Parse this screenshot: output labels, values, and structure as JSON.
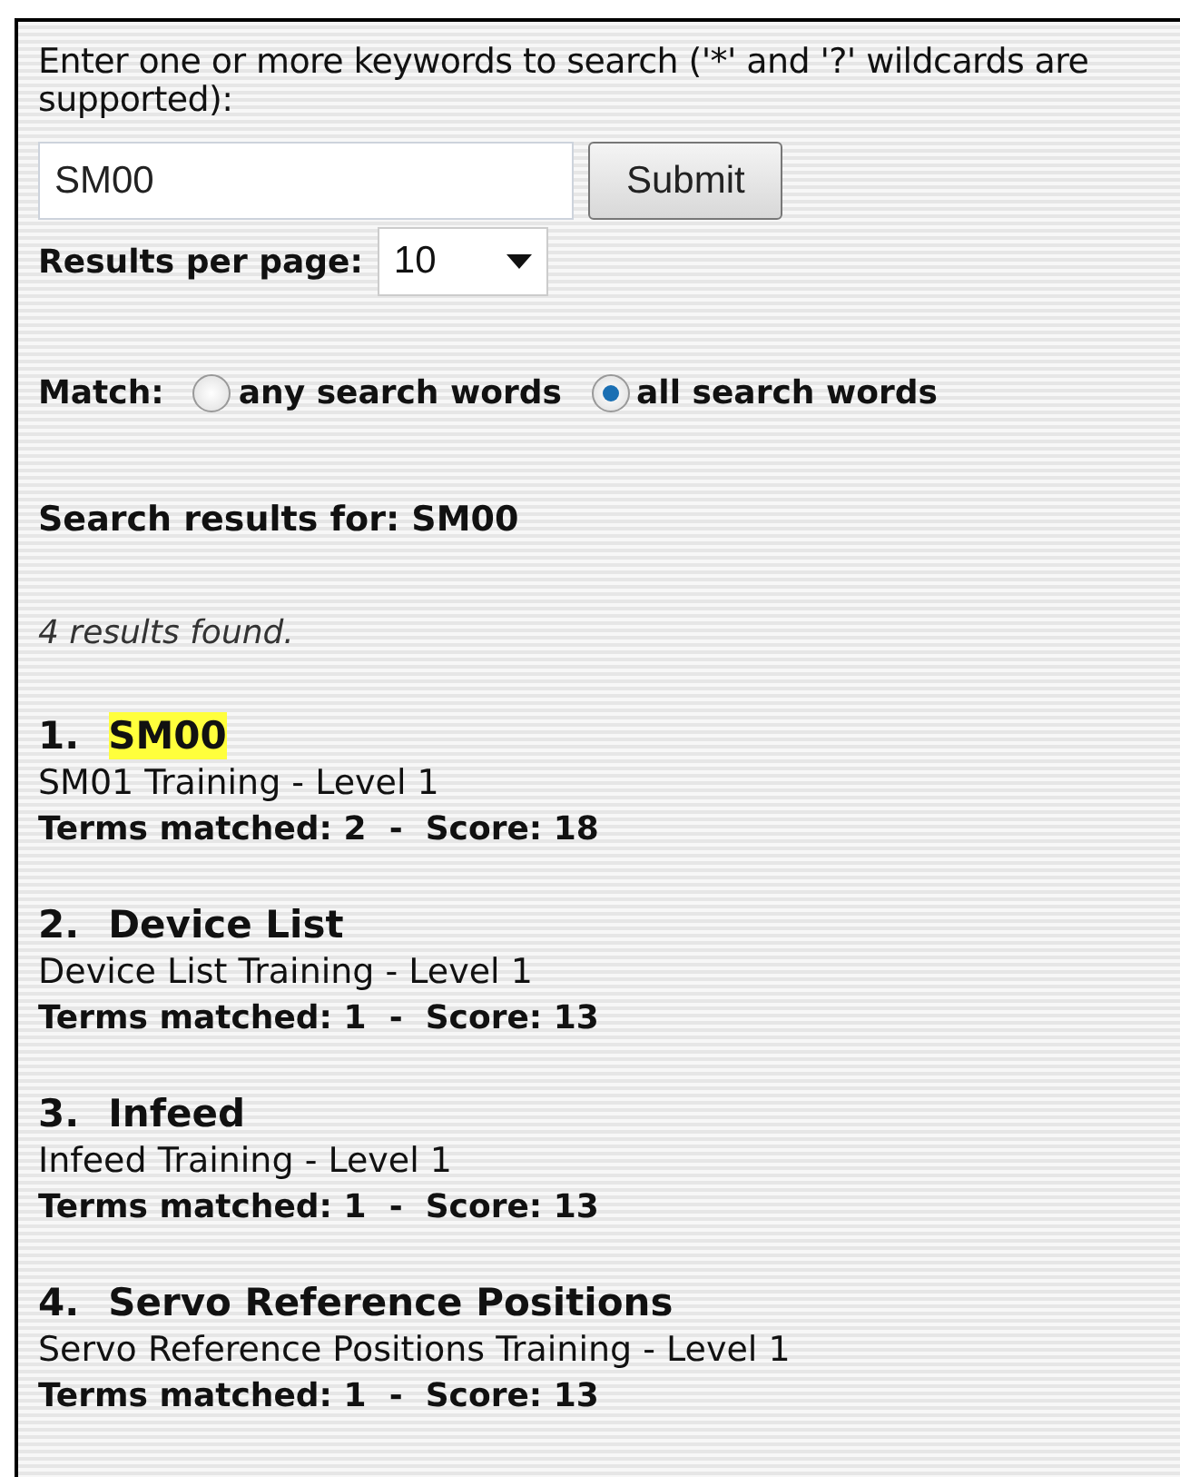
{
  "prompt": "Enter one or more keywords to search ('*' and '?' wildcards are supported):",
  "search": {
    "value": "SM00"
  },
  "submit_button": "Submit",
  "results_per_page": {
    "label": "Results per page:",
    "value": "10"
  },
  "match": {
    "label": "Match:",
    "options": [
      {
        "label": "any search words",
        "selected": false
      },
      {
        "label": "all search words",
        "selected": true
      }
    ]
  },
  "results_heading": "Search results for: SM00",
  "count": "4 results found.",
  "results": [
    {
      "number": "1.",
      "title": "SM00",
      "highlighted": true,
      "description": "SM01 Training - Level 1",
      "terms": "Terms matched: 2  -  Score: 18"
    },
    {
      "number": "2.",
      "title": "Device List",
      "highlighted": false,
      "description": "Device List Training - Level 1",
      "terms": "Terms matched: 1  -  Score: 13"
    },
    {
      "number": "3.",
      "title": "Infeed",
      "highlighted": false,
      "description": "Infeed Training - Level 1",
      "terms": "Terms matched: 1  -  Score: 13"
    },
    {
      "number": "4.",
      "title": "Servo Reference Positions",
      "highlighted": false,
      "description": "Servo Reference Positions Training - Level 1",
      "terms": "Terms matched: 1  -  Score: 13"
    }
  ]
}
